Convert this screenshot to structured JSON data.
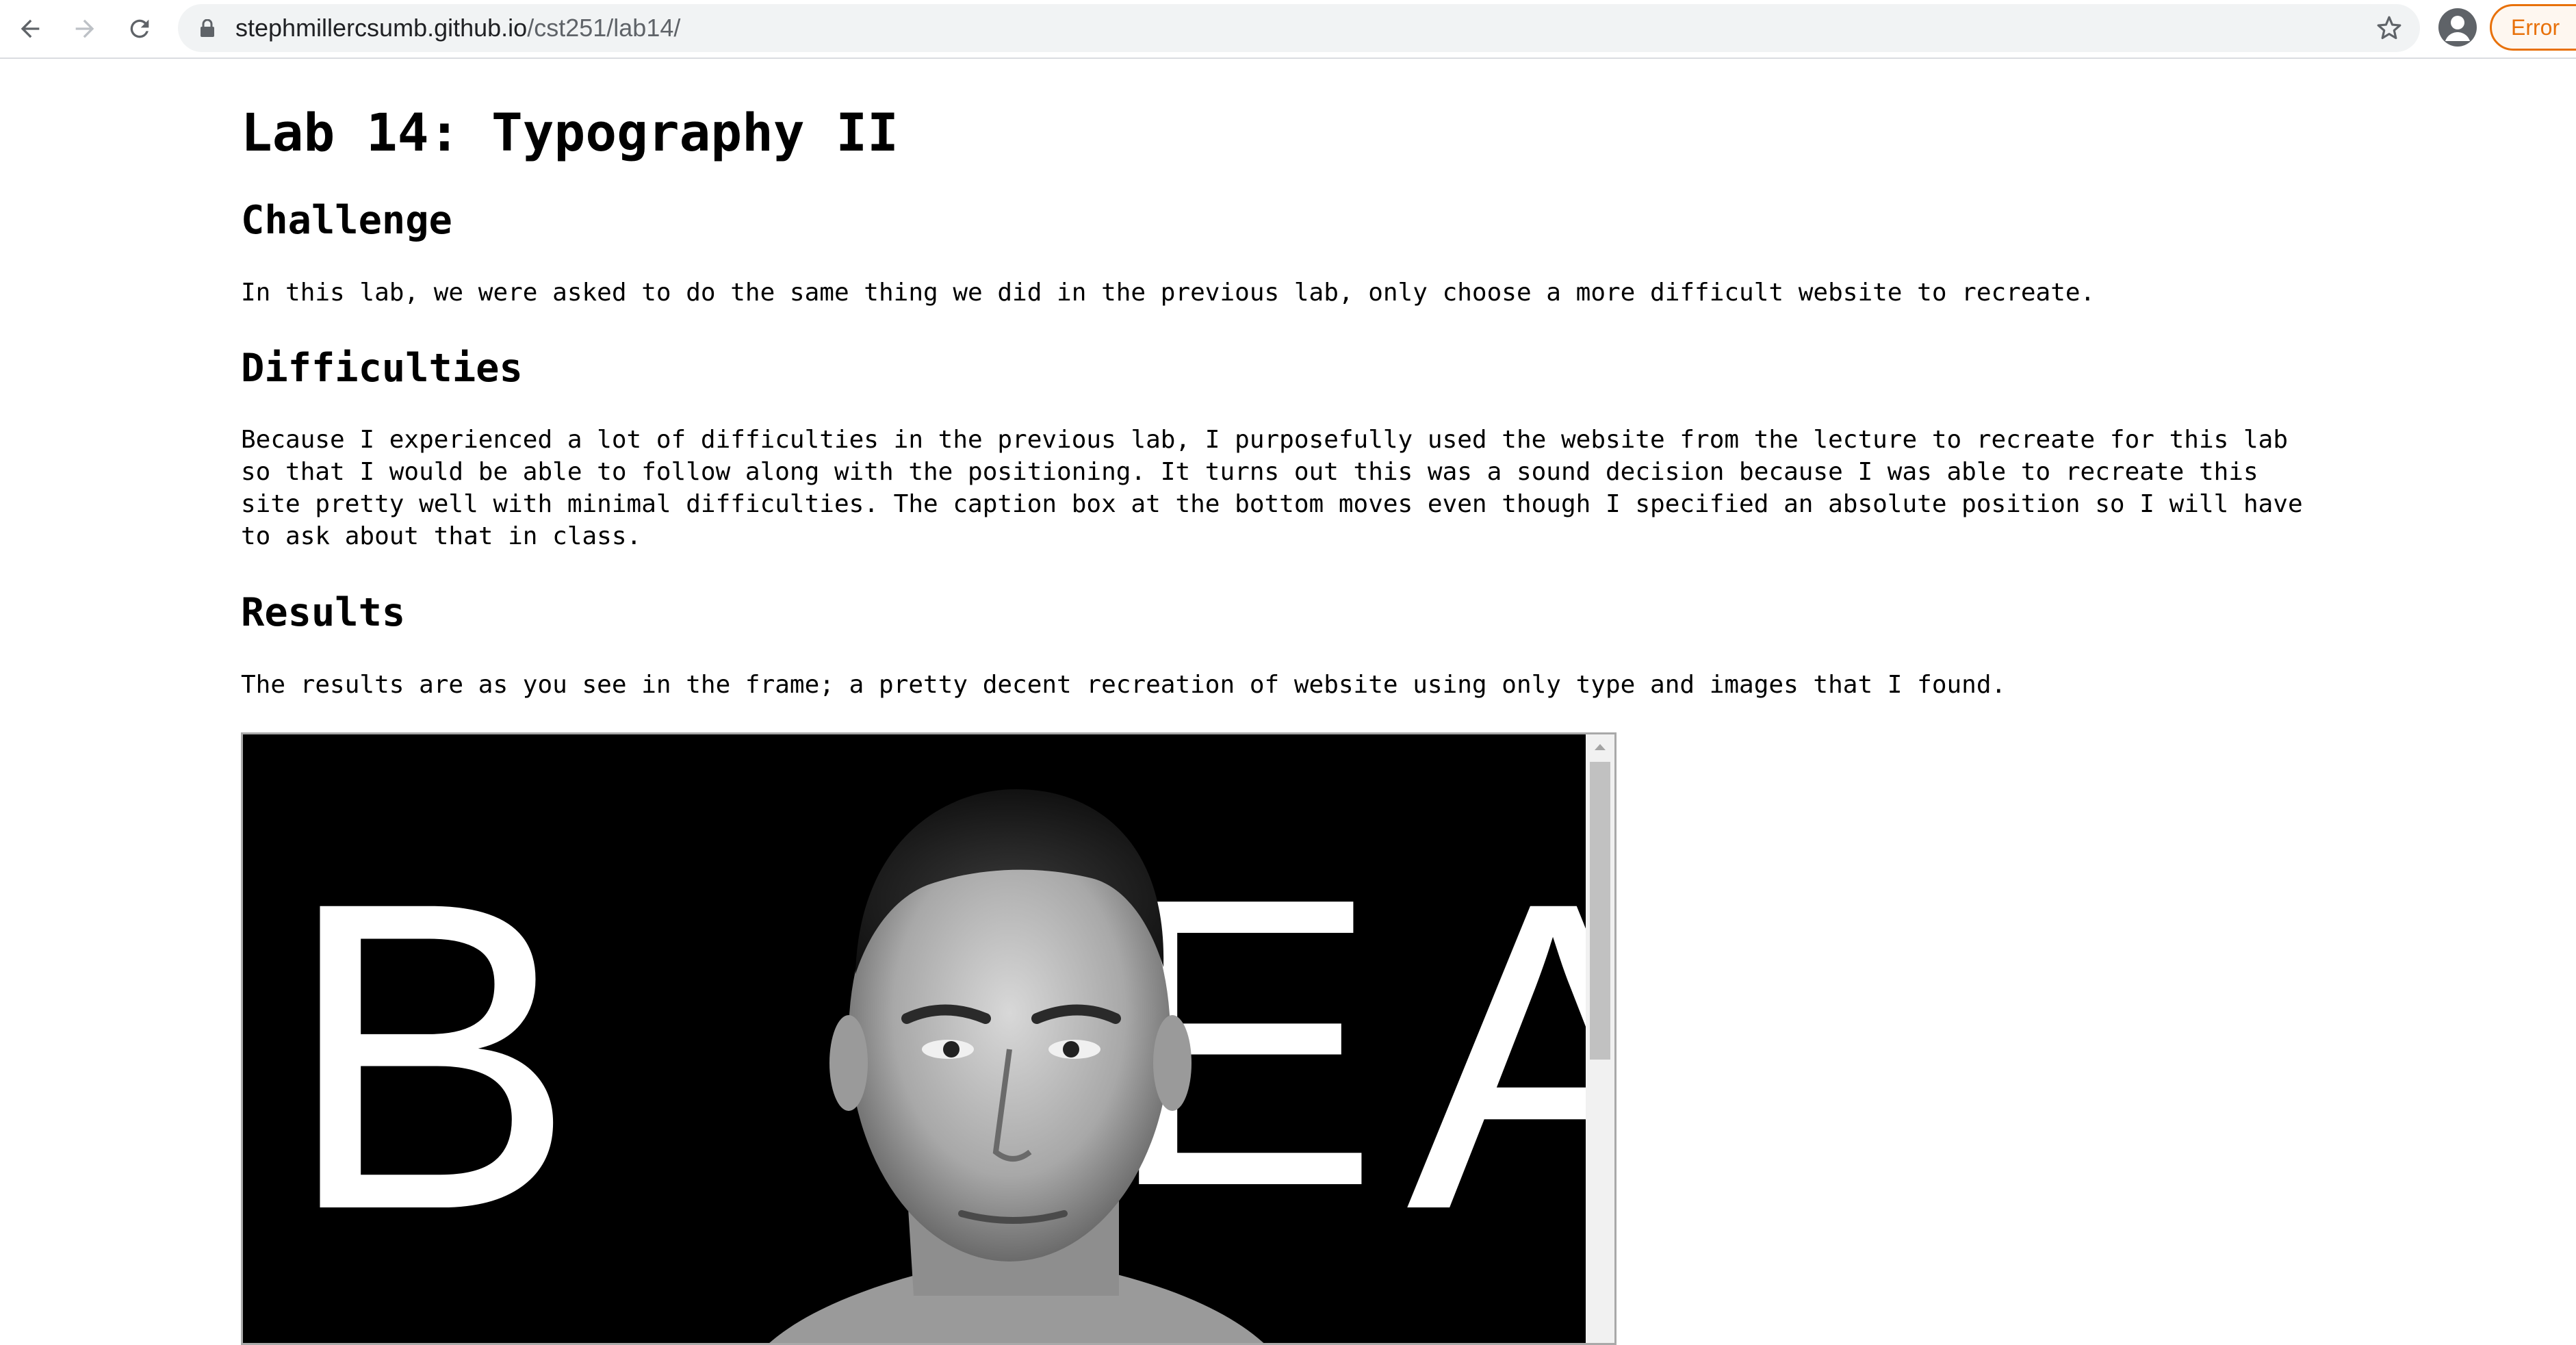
{
  "browser": {
    "url_host": "stephmillercsumb.github.io",
    "url_path": "/cst251/lab14/",
    "status_chip": "Error",
    "icons": [
      "back-arrow-icon",
      "forward-arrow-icon",
      "reload-icon",
      "lock-icon",
      "star-icon",
      "account-icon"
    ]
  },
  "page": {
    "title": "Lab 14: Typography II",
    "sections": [
      {
        "heading": "Challenge",
        "body": "In this lab, we were asked to do the same thing we did in the previous lab, only choose a more difficult website to recreate."
      },
      {
        "heading": "Difficulties",
        "body": "Because I experienced a lot of difficulties in the previous lab, I purposefully used the website from the lecture to recreate for this lab\nso that I would be able to follow along with the positioning. It turns out this was a sound decision because I was able to recreate this\nsite pretty well with minimal difficulties. The caption box at the bottom moves even though I specified an absolute position so I will have\nto ask about that in class."
      },
      {
        "heading": "Results",
        "body": "The results are as you see in the frame; a pretty decent recreation of website using only type and images that I found."
      }
    ]
  },
  "frame": {
    "letters": [
      "B",
      "E",
      "A"
    ],
    "image": "portrait-photo"
  }
}
